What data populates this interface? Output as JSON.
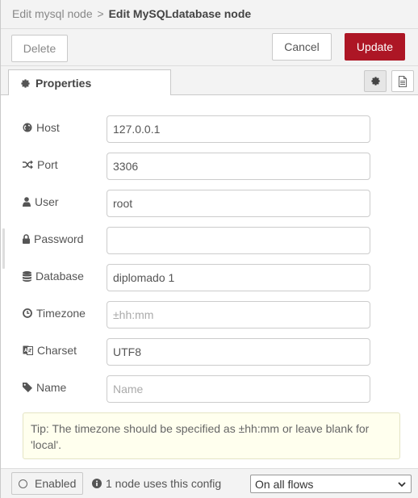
{
  "breadcrumb": {
    "parent": "Edit mysql node",
    "separator": ">",
    "current": "Edit MySQLdatabase node"
  },
  "toolbar": {
    "delete_label": "Delete",
    "cancel_label": "Cancel",
    "update_label": "Update"
  },
  "tabs": {
    "properties_label": "Properties"
  },
  "form": {
    "host": {
      "label": "Host",
      "value": "127.0.0.1",
      "placeholder": "",
      "icon": "globe-icon"
    },
    "port": {
      "label": "Port",
      "value": "3306",
      "placeholder": "",
      "icon": "random-icon"
    },
    "user": {
      "label": "User",
      "value": "root",
      "placeholder": "",
      "icon": "user-icon"
    },
    "password": {
      "label": "Password",
      "value": "",
      "placeholder": "",
      "icon": "lock-icon"
    },
    "database": {
      "label": "Database",
      "value": "diplomado 1",
      "placeholder": "",
      "icon": "database-icon"
    },
    "timezone": {
      "label": "Timezone",
      "value": "",
      "placeholder": "±hh:mm",
      "icon": "clock-icon"
    },
    "charset": {
      "label": "Charset",
      "value": "UTF8",
      "placeholder": "",
      "icon": "language-icon"
    },
    "name": {
      "label": "Name",
      "value": "",
      "placeholder": "Name",
      "icon": "tag-icon"
    }
  },
  "tip": "Tip: The timezone should be specified as ±hh:mm or leave blank for 'local'.",
  "footer": {
    "enabled_label": "Enabled",
    "usage_text": "1 node uses this config",
    "scope_value": "On all flows"
  },
  "colors": {
    "update_button": "#ad1625",
    "tip_background": "#ffffee",
    "panel_background": "#f3f3f3"
  }
}
